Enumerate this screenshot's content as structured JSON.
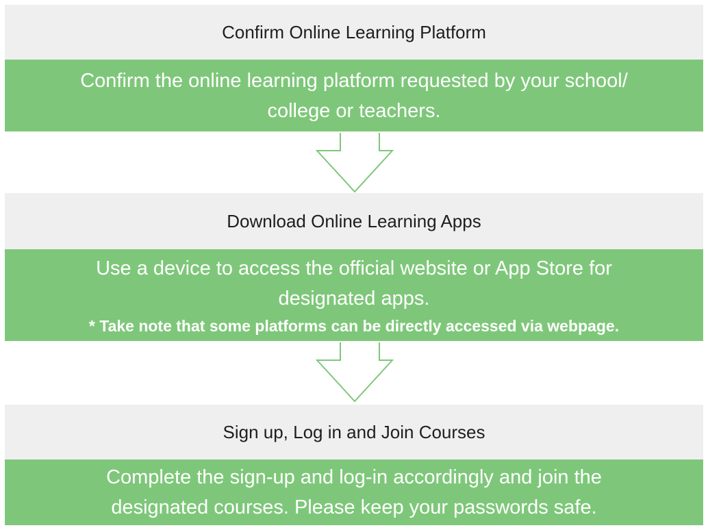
{
  "steps": [
    {
      "title": "Confirm Online Learning Platform",
      "lines": [
        "Confirm the online learning platform requested by your school/",
        "college or teachers."
      ]
    },
    {
      "title": "Download Online Learning Apps",
      "lines": [
        "Use a device to access the official website or App Store for",
        "designated apps."
      ],
      "note": "* Take note that some platforms can be directly accessed via webpage."
    },
    {
      "title": "Sign up, Log in and Join Courses",
      "lines": [
        "Complete the sign-up and log-in accordingly and join the",
        "designated courses. Please keep your passwords safe."
      ]
    }
  ],
  "colors": {
    "title_background": "#efefef",
    "box_background": "#7ec77a",
    "box_text": "#ffffff",
    "arrow_stroke": "#7ec77a"
  },
  "icons": {
    "arrow": "down-arrow-outline-icon"
  }
}
